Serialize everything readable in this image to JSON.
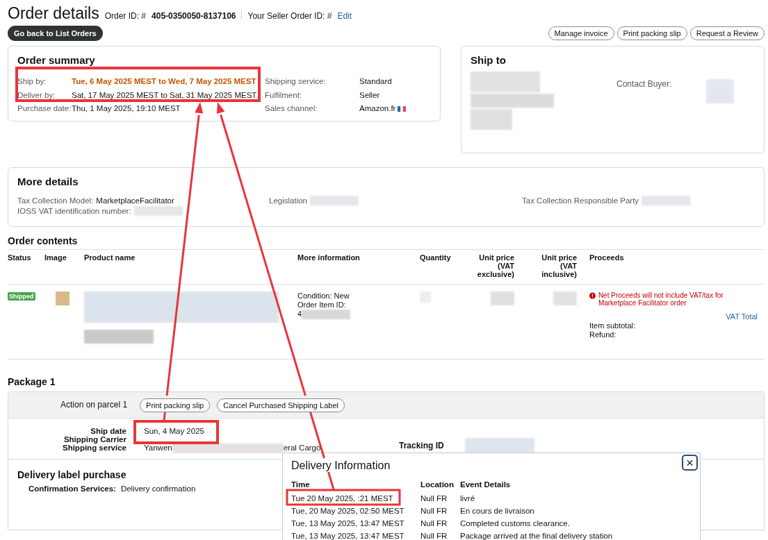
{
  "header": {
    "title": "Order details",
    "order_id_label": "Order ID: #",
    "order_id": "405-0350050-8137106",
    "seller_order_id_label": "Your Seller Order ID: #",
    "edit_link": "Edit",
    "back_button": "Go back to List Orders",
    "actions": [
      "Manage invoice",
      "Print packing slip",
      "Request a Review"
    ]
  },
  "order_summary": {
    "title": "Order summary",
    "left_rows": [
      {
        "label": "Ship by:",
        "value": "Tue, 6 May 2025 MEST to Wed, 7 May 2025 MEST",
        "emphasized": true
      },
      {
        "label": "Deliver by:",
        "value": "Sat, 17 May 2025 MEST to Sat, 31 May 2025 MEST",
        "emphasized": false
      },
      {
        "label": "Purchase date:",
        "value": "Thu, 1 May 2025, 19:10 MEST",
        "emphasized": false
      }
    ],
    "right_rows": [
      {
        "label": "Shipping service:",
        "value": "Standard"
      },
      {
        "label": "Fulfilment:",
        "value": "Seller"
      },
      {
        "label": "Sales channel:",
        "value": "Amazon.fr"
      }
    ]
  },
  "ship_to": {
    "title": "Ship to",
    "contact_label": "Contact Buyer:"
  },
  "more_details": {
    "title": "More details",
    "columns": [
      [
        {
          "label": "Tax Collection Model:",
          "value": "MarketplaceFacilitator"
        },
        {
          "label": "IOSS VAT identification number:"
        }
      ],
      [
        {
          "label": "Legislation"
        }
      ],
      [
        {
          "label": "Tax Collection Responsible Party"
        }
      ]
    ]
  },
  "order_contents": {
    "title": "Order contents",
    "columns": [
      "Status",
      "Image",
      "Product name",
      "More information",
      "Quantity",
      "Unit price (VAT exclusive)",
      "Unit price (VAT inclusive)",
      "Proceeds"
    ],
    "rows": [
      {
        "status": "Shipped",
        "more_information": [
          "Condition: New",
          "Order Item ID:",
          "4"
        ],
        "notice": "Net Proceeds will not include VAT/tax for Marketplace Facilitator order",
        "vat_link": "VAT Total",
        "totals": [
          "Item subtotal:",
          "Refund:"
        ]
      }
    ]
  },
  "package": {
    "title": "Package 1",
    "action_label": "Action on parcel 1",
    "actions": [
      "Print packing slip",
      "Cancel Purchased Shipping Label"
    ],
    "fields": [
      {
        "label": "Ship date",
        "value": "Sun, 4 May 2025"
      },
      {
        "label": "Shipping Carrier"
      },
      {
        "label": "Shipping service",
        "value": "Yanwen",
        "value_tail": "eral Cargo"
      }
    ],
    "tracking_label": "Tracking ID",
    "label_purchase": {
      "title": "Delivery label purchase",
      "label": "Confirmation Services:",
      "value": "Delivery confirmation"
    }
  },
  "delivery_popup": {
    "title": "Delivery Information",
    "close": "×",
    "columns": [
      "Time",
      "Location",
      "Event Details"
    ],
    "rows": [
      [
        "Tue 20 May 2025, :21 MEST",
        "Null FR",
        "livré"
      ],
      [
        "Tue, 20 May 2025, 02:50 MEST",
        "Null FR",
        "En cours de livraison"
      ],
      [
        "Tue, 13 May 2025, 13:47 MEST",
        "Null FR",
        "Completed customs clearance."
      ],
      [
        "Tue, 13 May 2025, 13:47 MEST",
        "Null FR",
        "Package arrived at the final delivery station"
      ]
    ]
  }
}
